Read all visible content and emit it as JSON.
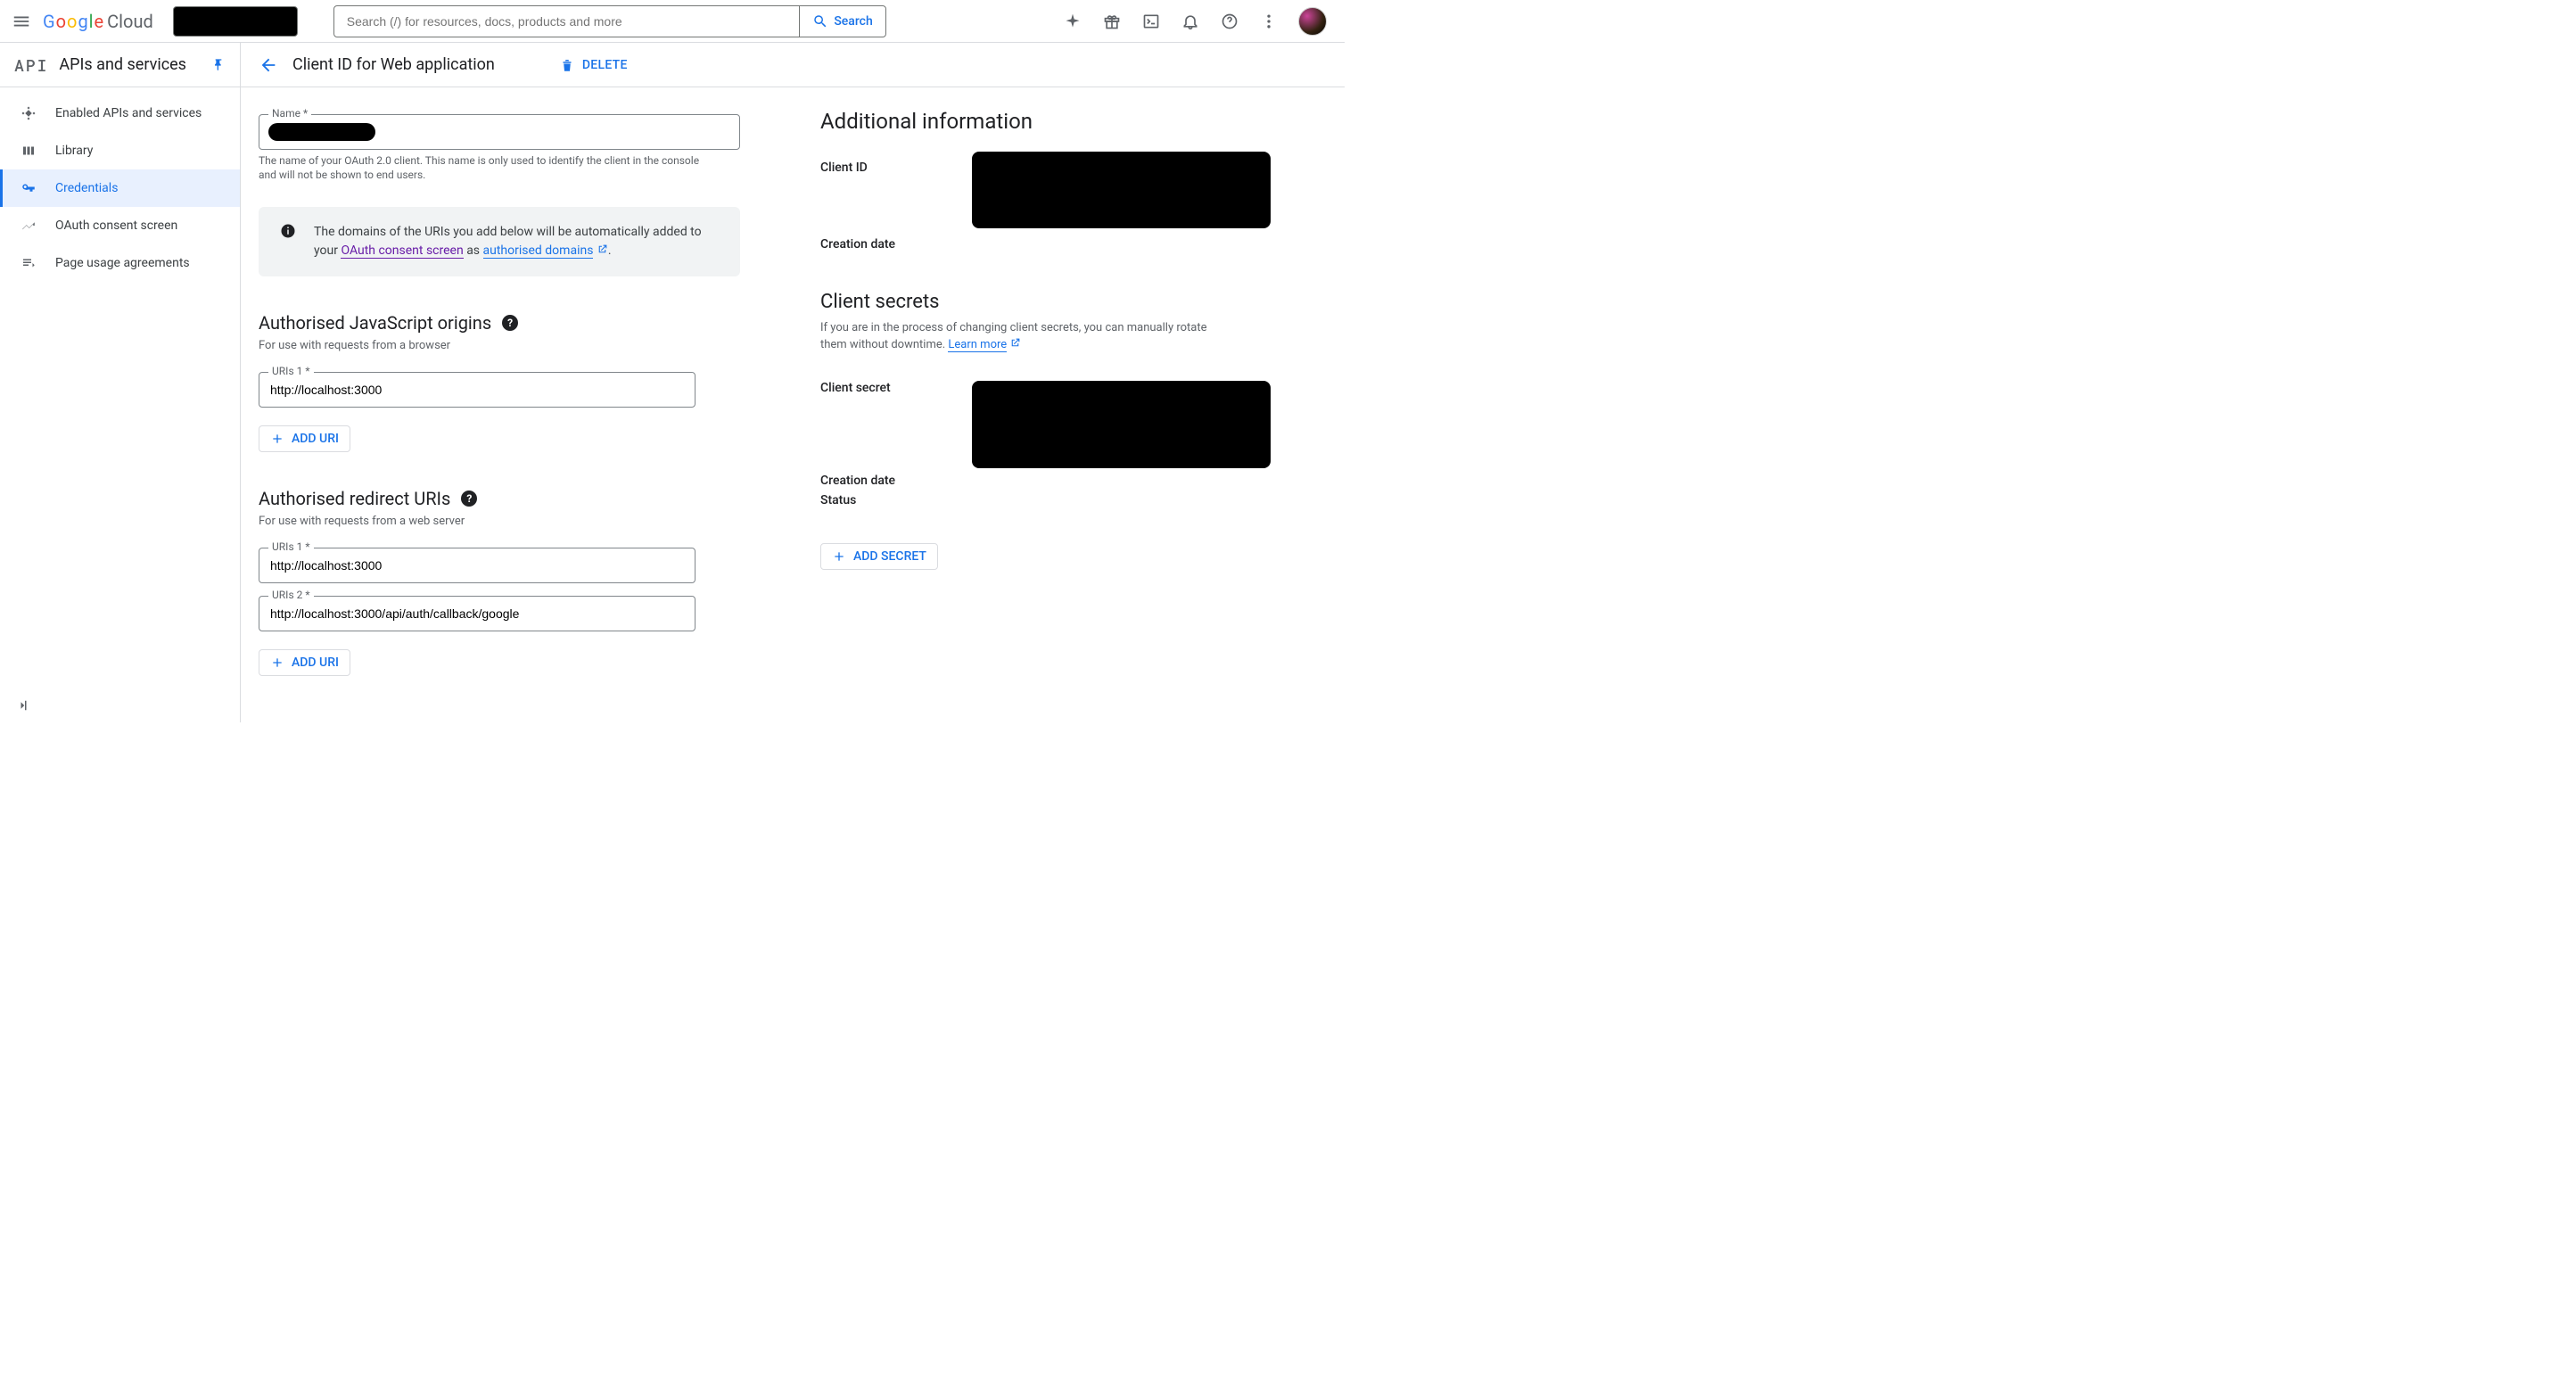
{
  "topbar": {
    "logo_letters": [
      "G",
      "o",
      "o",
      "g",
      "l",
      "e"
    ],
    "logo_cloud": "Cloud",
    "search_placeholder": "Search (/) for resources, docs, products and more",
    "search_button": "Search"
  },
  "sidebar": {
    "api_label": "API",
    "title": "APIs and services",
    "items": [
      {
        "icon": "enabled-apis-icon",
        "label": "Enabled APIs and services"
      },
      {
        "icon": "library-icon",
        "label": "Library"
      },
      {
        "icon": "key-icon",
        "label": "Credentials",
        "active": true
      },
      {
        "icon": "consent-icon",
        "label": "OAuth consent screen"
      },
      {
        "icon": "agreement-icon",
        "label": "Page usage agreements"
      }
    ]
  },
  "main": {
    "page_title": "Client ID for Web application",
    "delete_label": "DELETE",
    "name_field": {
      "label": "Name *",
      "help": "The name of your OAuth 2.0 client. This name is only used to identify the client in the console and will not be shown to end users."
    },
    "info_banner": {
      "text_pre": "The domains of the URIs you add below will be automatically added to your ",
      "link1": "OAuth consent screen",
      "text_mid": " as ",
      "link2": "authorised domains",
      "text_post": "."
    },
    "js_origins": {
      "title": "Authorised JavaScript origins",
      "sub": "For use with requests from a browser",
      "uris": [
        {
          "label": "URIs 1 *",
          "value": "http://localhost:3000"
        }
      ],
      "add": "ADD URI"
    },
    "redirect_uris": {
      "title": "Authorised redirect URIs",
      "sub": "For use with requests from a web server",
      "uris": [
        {
          "label": "URIs 1 *",
          "value": "http://localhost:3000"
        },
        {
          "label": "URIs 2 *",
          "value": "http://localhost:3000/api/auth/callback/google"
        }
      ],
      "add": "ADD URI"
    }
  },
  "side_info": {
    "title": "Additional information",
    "client_id_label": "Client ID",
    "creation_date_label": "Creation date",
    "secrets_title": "Client secrets",
    "secrets_help_pre": "If you are in the process of changing client secrets, you can manually rotate them without downtime. ",
    "secrets_help_link": "Learn more",
    "client_secret_label": "Client secret",
    "creation_date2_label": "Creation date",
    "status_label": "Status",
    "add_secret": "ADD SECRET"
  }
}
